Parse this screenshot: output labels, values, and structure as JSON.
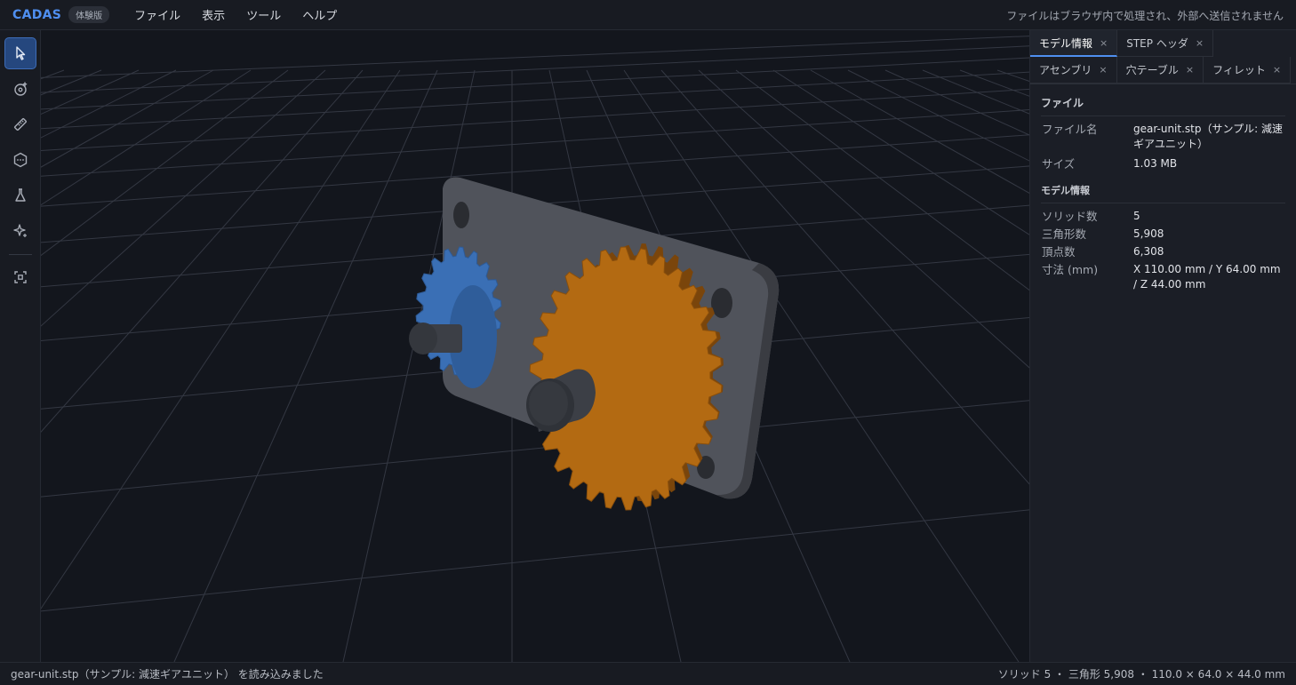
{
  "app": {
    "logo": "CADAS",
    "badge": "体験版",
    "menu": [
      "ファイル",
      "表示",
      "ツール",
      "ヘルプ"
    ],
    "notice": "ファイルはブラウザ内で処理され、外部へ送信されません"
  },
  "toolbar": {
    "tools": [
      {
        "name": "select-tool",
        "icon": "cursor-icon"
      },
      {
        "name": "orbit-tool",
        "icon": "orbit-plus-icon"
      },
      {
        "name": "measure-tool",
        "icon": "ruler-icon"
      },
      {
        "name": "section-tool",
        "icon": "hexagon-dots-icon"
      },
      {
        "name": "explode-tool",
        "icon": "flask-icon"
      },
      {
        "name": "effects-tool",
        "icon": "sparkle-icon"
      },
      {
        "name": "fit-view-tool",
        "icon": "focus-frame-icon"
      }
    ]
  },
  "panel": {
    "tabs": [
      {
        "label": "モデル情報",
        "close": "×"
      },
      {
        "label": "STEP ヘッダ",
        "close": "×"
      },
      {
        "label": "アセンブリ",
        "close": "×"
      },
      {
        "label": "穴テーブル",
        "close": "×"
      },
      {
        "label": "フィレット",
        "close": "×"
      }
    ],
    "file_section": {
      "title": "ファイル",
      "rows": [
        {
          "k": "ファイル名",
          "v": "gear-unit.stp（サンプル: 減速ギアユニット）"
        },
        {
          "k": "サイズ",
          "v": "1.03 MB"
        }
      ]
    },
    "model_section": {
      "title": "モデル情報",
      "rows": [
        {
          "k": "ソリッド数",
          "v": "5"
        },
        {
          "k": "三角形数",
          "v": "5,908"
        },
        {
          "k": "頂点数",
          "v": "6,308"
        },
        {
          "k": "寸法 (mm)",
          "v": "X 110.00 mm / Y 64.00 mm / Z 44.00 mm"
        }
      ]
    }
  },
  "status": {
    "left": "gear-unit.stp（サンプル: 減速ギアユニット） を読み込みました",
    "right": "ソリッド 5 ・ 三角形 5,908 ・ 110.0 × 64.0 × 44.0 mm"
  },
  "colors": {
    "accent": "#4f8ff0",
    "gear_large": "#b36a12",
    "gear_small": "#3a6fb5",
    "plate": "#4a4d54"
  }
}
